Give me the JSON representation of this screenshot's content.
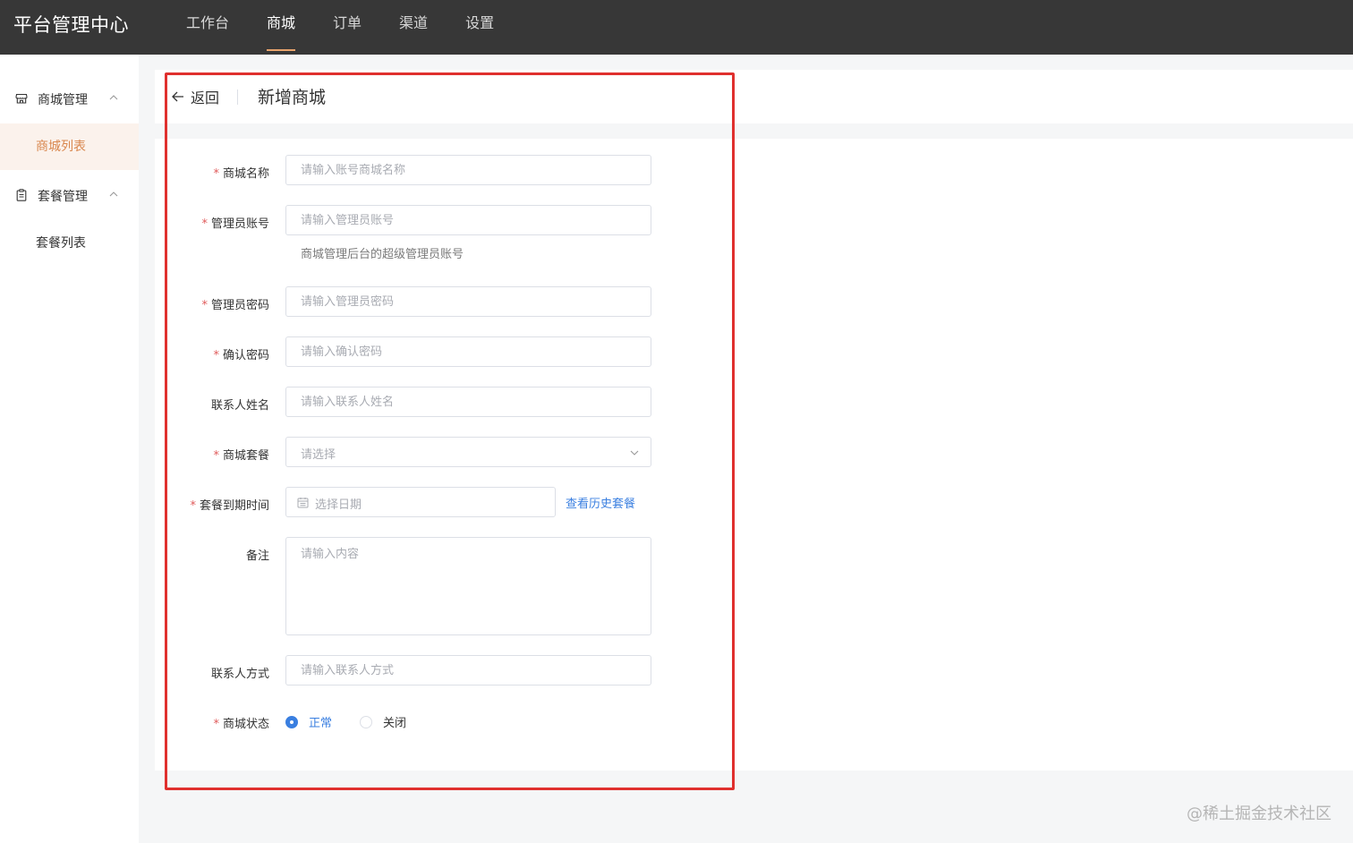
{
  "topbar": {
    "brand": "平台管理中心",
    "nav": [
      {
        "label": "工作台",
        "active": false
      },
      {
        "label": "商城",
        "active": true
      },
      {
        "label": "订单",
        "active": false
      },
      {
        "label": "渠道",
        "active": false
      },
      {
        "label": "设置",
        "active": false
      }
    ]
  },
  "sidebar": {
    "groups": [
      {
        "icon": "store-icon",
        "label": "商城管理",
        "items": [
          {
            "label": "商城列表",
            "active": true
          }
        ]
      },
      {
        "icon": "clipboard-icon",
        "label": "套餐管理",
        "items": [
          {
            "label": "套餐列表",
            "active": false
          }
        ]
      }
    ]
  },
  "header": {
    "back_label": "返回",
    "title": "新增商城"
  },
  "form": {
    "required_mark": "*",
    "mall_name": {
      "label": "商城名称",
      "placeholder": "请输入账号商城名称",
      "required": true
    },
    "admin_account": {
      "label": "管理员账号",
      "placeholder": "请输入管理员账号",
      "hint": "商城管理后台的超级管理员账号",
      "required": true
    },
    "admin_password": {
      "label": "管理员密码",
      "placeholder": "请输入管理员密码",
      "required": true
    },
    "confirm_password": {
      "label": "确认密码",
      "placeholder": "请输入确认密码",
      "required": true
    },
    "contact_name": {
      "label": "联系人姓名",
      "placeholder": "请输入联系人姓名",
      "required": false
    },
    "mall_package": {
      "label": "商城套餐",
      "placeholder": "请选择",
      "required": true
    },
    "package_expiry": {
      "label": "套餐到期时间",
      "placeholder": "选择日期",
      "link": "查看历史套餐",
      "required": true
    },
    "remark": {
      "label": "备注",
      "placeholder": "请输入内容",
      "required": false
    },
    "contact_method": {
      "label": "联系人方式",
      "placeholder": "请输入联系人方式",
      "required": false
    },
    "mall_status": {
      "label": "商城状态",
      "required": true,
      "options": [
        {
          "label": "正常",
          "checked": true
        },
        {
          "label": "关闭",
          "checked": false
        }
      ]
    }
  },
  "colors": {
    "topbar": "#373737",
    "accent": "#d9874e",
    "link": "#3a7fe0",
    "required": "#e05b5b",
    "highlight": "#e0302e"
  },
  "watermark": "@稀土掘金技术社区"
}
